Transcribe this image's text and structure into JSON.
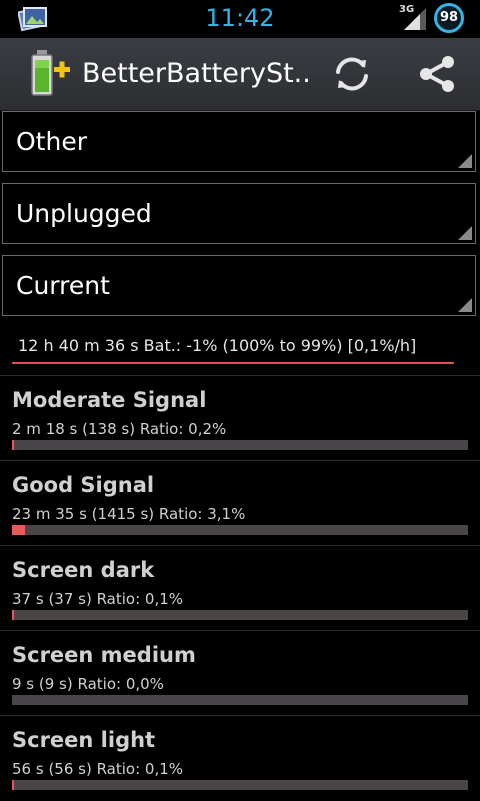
{
  "status_bar": {
    "time": "11:42",
    "network_type": "3G",
    "battery_level": "98",
    "notification_icon": "photo-gallery-icon",
    "accent_color": "#33b5e5"
  },
  "action_bar": {
    "title": "BetterBatterySt..",
    "app_icon": "battery-plus-icon",
    "refresh_icon": "refresh-icon",
    "share_icon": "share-icon"
  },
  "filters": [
    {
      "label": "Other"
    },
    {
      "label": "Unplugged"
    },
    {
      "label": "Current"
    }
  ],
  "summary": {
    "text": "12 h 40 m 36 s  Bat.: -1% (100% to 99%) [0,1%/h]"
  },
  "stats": [
    {
      "title": "Moderate Signal",
      "detail": "2 m 18 s  (138 s) Ratio: 0,2%",
      "ratio": 0.002
    },
    {
      "title": "Good Signal",
      "detail": "23 m 35 s  (1415 s) Ratio: 3,1%",
      "ratio": 0.031
    },
    {
      "title": "Screen dark",
      "detail": "37 s  (37 s) Ratio: 0,1%",
      "ratio": 0.001
    },
    {
      "title": "Screen medium",
      "detail": "9 s  (9 s) Ratio: 0,0%",
      "ratio": 0.0
    },
    {
      "title": "Screen light",
      "detail": "56 s  (56 s) Ratio: 0,1%",
      "ratio": 0.001
    }
  ]
}
